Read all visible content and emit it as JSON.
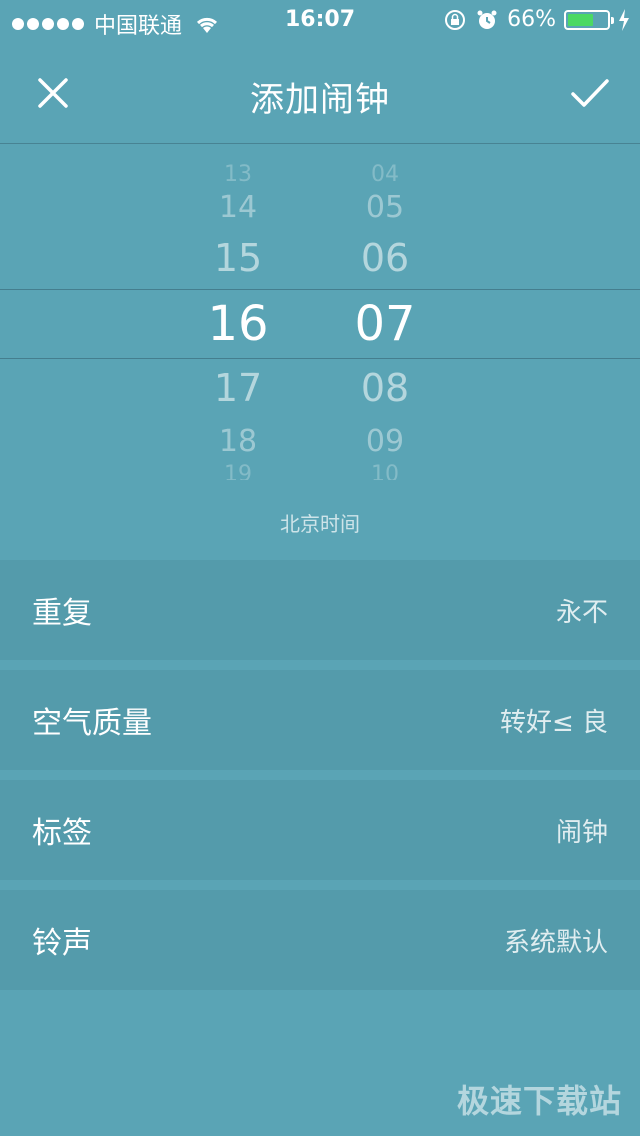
{
  "status_bar": {
    "carrier": "中国联通",
    "time": "16:07",
    "battery_percent": "66%",
    "battery_level": 0.66,
    "battery_color": "#4cd964"
  },
  "nav": {
    "title": "添加闹钟",
    "close_icon": "close-icon",
    "confirm_icon": "check-icon"
  },
  "picker": {
    "hours": [
      "13",
      "14",
      "15",
      "16",
      "17",
      "18",
      "19"
    ],
    "minutes": [
      "04",
      "05",
      "06",
      "07",
      "08",
      "09",
      "10"
    ],
    "selected_hour": "16",
    "selected_minute": "07",
    "timezone": "北京时间"
  },
  "settings": [
    {
      "label": "重复",
      "value": "永不"
    },
    {
      "label": "空气质量",
      "value": "转好≤ 良"
    },
    {
      "label": "标签",
      "value": "闹钟"
    },
    {
      "label": "铃声",
      "value": "系统默认"
    }
  ],
  "watermark": "极速下载站",
  "colors": {
    "background": "#5aa4b5",
    "row_background": "#549bab"
  }
}
